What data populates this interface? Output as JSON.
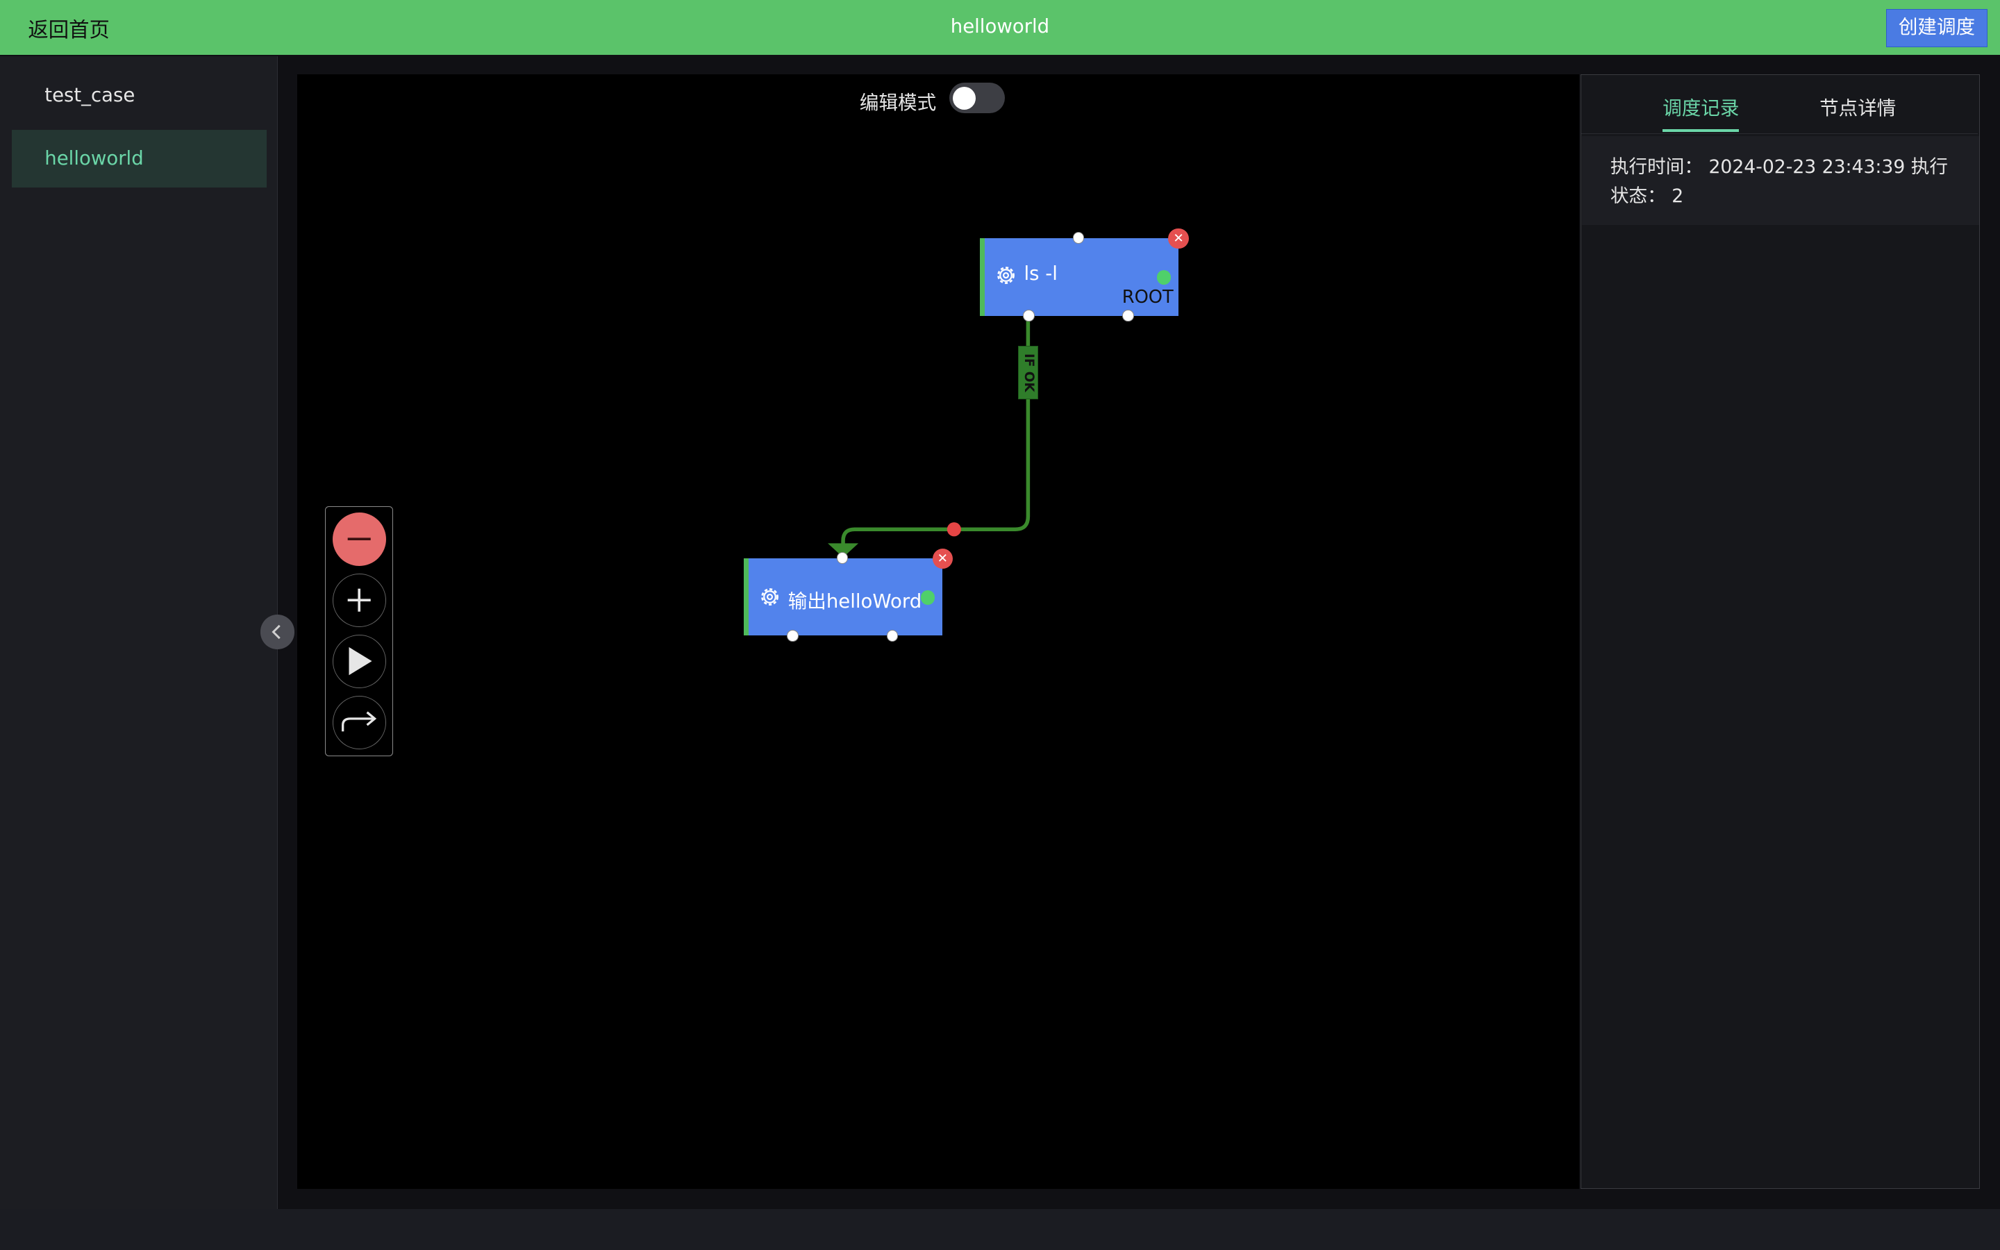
{
  "header": {
    "back_label": "返回首页",
    "title": "helloworld",
    "create_label": "创建调度"
  },
  "sidebar": {
    "items": [
      {
        "label": "test_case"
      },
      {
        "label": "helloworld"
      }
    ]
  },
  "canvas": {
    "edit_mode_label": "编辑模式",
    "edit_mode_on": false,
    "nodes": [
      {
        "label": "ls -l",
        "badge": "ROOT"
      },
      {
        "label": "输出helloWord"
      }
    ],
    "edge_label": "IF OK",
    "controls": [
      "minus-icon",
      "plus-icon",
      "play-icon",
      "redo-arrow-icon"
    ]
  },
  "panel": {
    "tabs": [
      {
        "label": "调度记录"
      },
      {
        "label": "节点详情"
      }
    ],
    "record": {
      "time_label": "执行时间：",
      "time_value": "2024-02-23 23:43:39",
      "status_label": "执行状态：",
      "status_value": "2"
    }
  },
  "colors": {
    "header": "#5bc36a",
    "node": "#5283ec",
    "accent": "#6bd6a8",
    "edge": "#3a8a2c",
    "danger": "#e55050"
  }
}
